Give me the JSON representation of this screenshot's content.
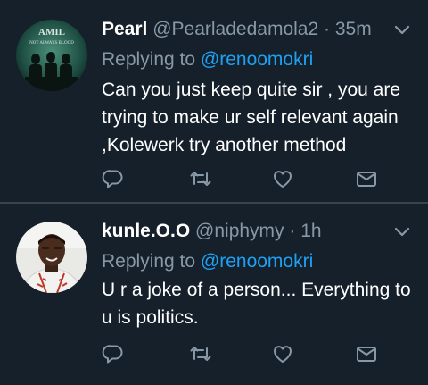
{
  "tweets": [
    {
      "name": "Pearl",
      "handle": "@Pearladedamola2",
      "separator": "·",
      "time": "35m",
      "replying_prefix": "Replying to",
      "replying_to": "@renoomokri",
      "text": "Can you just keep quite sir , you are trying to make ur self relevant again ,Kolewerk try another method",
      "avatar_caption": "NOT ALWAYS BLOOD",
      "avatar_logo": "AMIL"
    },
    {
      "name": "kunle.O.O",
      "handle": "@niphymy",
      "separator": "·",
      "time": "1h",
      "replying_prefix": "Replying to",
      "replying_to": "@renoomokri",
      "text": "U r a joke of a person... Everything to u is politics."
    }
  ],
  "icons": {
    "reply": "reply-icon",
    "retweet": "retweet-icon",
    "like": "like-icon",
    "share": "share-icon",
    "menu": "chevron-down-icon"
  },
  "colors": {
    "background": "#15202b",
    "divider": "#38444d",
    "secondary_text": "#8899a6",
    "link": "#1da1f2"
  }
}
